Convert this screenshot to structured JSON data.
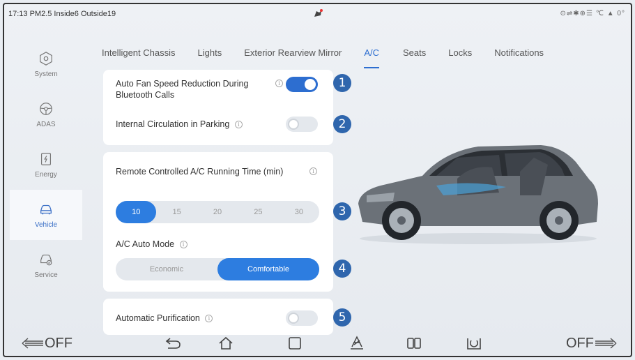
{
  "status_bar": {
    "left_text": "17:13 PM2.5 Inside6 Outside19",
    "right_text": "⊙⇌✱⊕☰ ℃ ▲ 0°"
  },
  "sidebar": {
    "items": [
      {
        "label": "System",
        "icon": "hexagon-icon"
      },
      {
        "label": "ADAS",
        "icon": "steering-wheel-icon"
      },
      {
        "label": "Energy",
        "icon": "battery-icon"
      },
      {
        "label": "Vehicle",
        "icon": "car-icon",
        "active": true
      },
      {
        "label": "Service",
        "icon": "car-service-icon"
      }
    ]
  },
  "tabs": [
    {
      "label": "Intelligent Chassis"
    },
    {
      "label": "Lights"
    },
    {
      "label": "Exterior Rearview Mirror"
    },
    {
      "label": "A/C",
      "active": true
    },
    {
      "label": "Seats"
    },
    {
      "label": "Locks"
    },
    {
      "label": "Notifications"
    }
  ],
  "settings": {
    "auto_fan_label": "Auto Fan Speed Reduction During Bluetooth Calls",
    "auto_fan_on": true,
    "internal_circ_label": "Internal Circulation in Parking",
    "internal_circ_on": false,
    "remote_ac_label": "Remote Controlled A/C Running Time (min)",
    "remote_ac_options": [
      "10",
      "15",
      "20",
      "25",
      "30"
    ],
    "remote_ac_selected": "10",
    "ac_auto_mode_label": "A/C Auto Mode",
    "ac_auto_mode_options": [
      "Economic",
      "Comfortable"
    ],
    "ac_auto_mode_selected": "Comfortable",
    "auto_purification_label": "Automatic Purification",
    "auto_purification_on": false
  },
  "badges": [
    "1",
    "2",
    "3",
    "4",
    "5"
  ],
  "info_symbol": "i",
  "bottom_bar": {
    "left_label": "OFF",
    "right_label": "OFF",
    "buttons": [
      "back-icon",
      "home-icon",
      "square-icon",
      "fan-icon",
      "split-screen-icon",
      "camera-icon"
    ]
  },
  "colors": {
    "accent": "#2d6ed0",
    "badge": "#2f66ad",
    "segment_selected": "#2d7de0"
  }
}
